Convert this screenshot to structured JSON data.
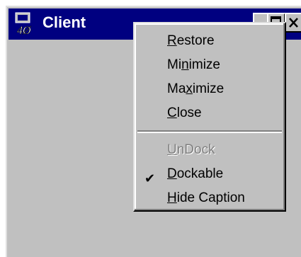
{
  "window": {
    "title": "Client"
  },
  "titlebar": {
    "buttons": [
      "minimize",
      "maximize",
      "close"
    ]
  },
  "menu": {
    "items": [
      {
        "label": "Restore",
        "underline": "R"
      },
      {
        "label": "Minimize",
        "underline": "n"
      },
      {
        "label": "Maximize",
        "underline": "x"
      },
      {
        "label": "Close",
        "underline": "C"
      },
      {
        "label": "UnDock",
        "underline": "U",
        "disabled": true
      },
      {
        "label": "Dockable",
        "underline": "D",
        "checked": true
      },
      {
        "label": "Hide Caption",
        "underline": "H"
      }
    ]
  },
  "colors": {
    "titlebar": "#000080",
    "face": "#c0c0c0",
    "disabled_text": "#808080"
  }
}
